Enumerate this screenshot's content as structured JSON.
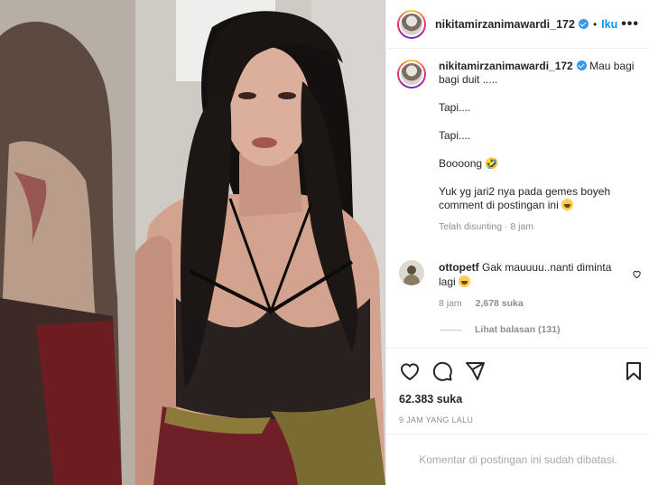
{
  "header": {
    "username": "nikitamirzanimawardi_172",
    "separator": "•",
    "follow_label": "Iku",
    "more_label": "•••"
  },
  "caption": {
    "username": "nikitamirzanimawardi_172",
    "lines": [
      "Mau bagi bagi duit .....",
      "Tapi....",
      "Tapi....",
      "Boooong 🤣",
      "Yuk yg jari2 nya pada gemes boyeh comment di postingan ini"
    ],
    "edited": "Telah disunting · 8 jam"
  },
  "comment": {
    "username": "ottopetf",
    "text": "Gak mauuuu..nanti diminta lagi",
    "time": "8 jam",
    "likes": "2,678 suka"
  },
  "replies_label": "Lihat balasan (131)",
  "likes": "62.383 suka",
  "timestamp": "9 JAM YANG LALU",
  "comments_limited": "Komentar di postingan ini sudah dibatasi.",
  "colors": {
    "accent": "#0095f6",
    "muted": "#8e8e8e",
    "border": "#efefef"
  }
}
